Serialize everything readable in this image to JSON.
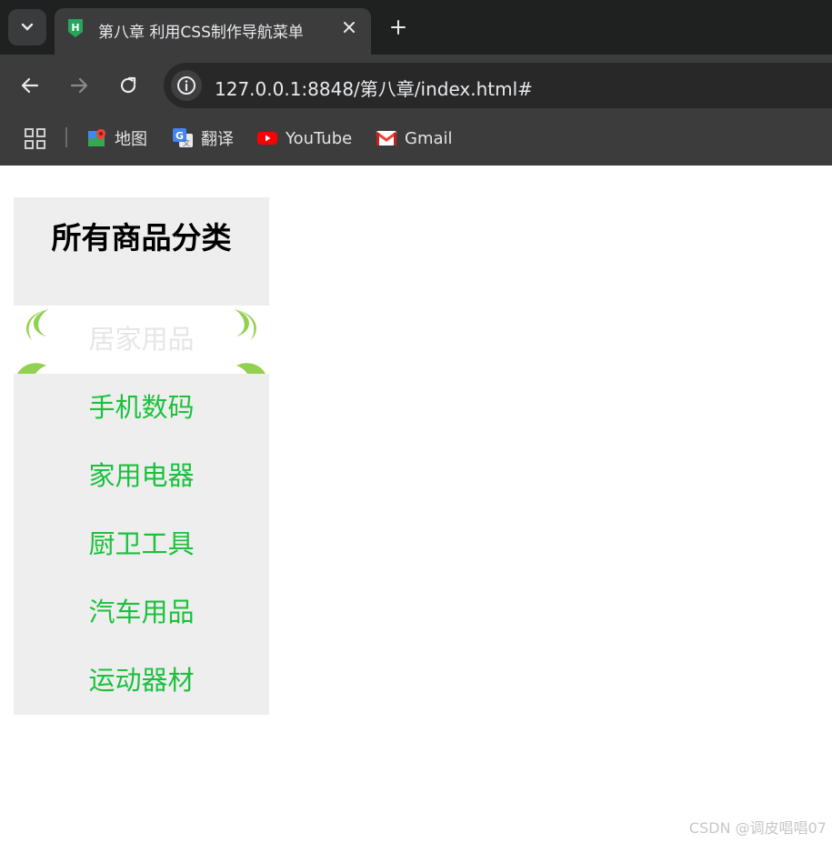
{
  "browser": {
    "tab": {
      "title": "第八章 利用CSS制作导航菜单",
      "favicon": "hbuilder-icon"
    },
    "url": "127.0.0.1:8848/第八章/index.html#",
    "bookmarks": [
      {
        "label": "地图",
        "icon": "maps-icon"
      },
      {
        "label": "翻译",
        "icon": "translate-icon"
      },
      {
        "label": "YouTube",
        "icon": "youtube-icon"
      },
      {
        "label": "Gmail",
        "icon": "gmail-icon"
      }
    ]
  },
  "page": {
    "title": "所有商品分类",
    "nav_items": [
      {
        "label": "居家用品",
        "active": true
      },
      {
        "label": "手机数码",
        "active": false
      },
      {
        "label": "家用电器",
        "active": false
      },
      {
        "label": "厨卫工具",
        "active": false
      },
      {
        "label": "汽车用品",
        "active": false
      },
      {
        "label": "运动器材",
        "active": false
      }
    ],
    "watermark": "CSDN @调皮唱唱07"
  },
  "colors": {
    "link": "#1bc13d",
    "active_text": "#e6e6e6",
    "nav_bg": "#eeeeee",
    "active_ornament": "#92d050"
  }
}
